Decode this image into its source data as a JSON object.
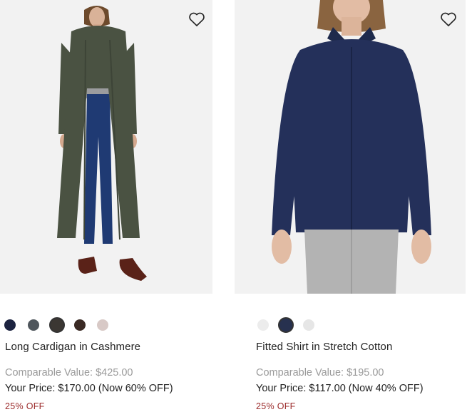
{
  "products": [
    {
      "name": "Long Cardigan in Cashmere",
      "comparable_value": "Comparable Value: $425.00",
      "your_price": "Your Price: $170.00 (Now 60% OFF)",
      "discount": "25% OFF",
      "favorite_icon": "heart-outline-icon",
      "swatches": [
        "#1c2340",
        "#4f565c",
        "#3b3733",
        "#3a2a24",
        "#d8c9c6"
      ],
      "selected_swatch": 2
    },
    {
      "name": "Fitted Shirt in Stretch Cotton",
      "comparable_value": "Comparable Value: $195.00",
      "your_price": "Your Price: $117.00 (Now 40% OFF)",
      "discount": "25% OFF",
      "favorite_icon": "heart-outline-icon",
      "swatches": [
        "#ececec",
        "#27314f",
        "#e6e6e6"
      ],
      "selected_swatch": 1
    }
  ],
  "colors": {
    "discount": "#9b2a2a",
    "comparable": "#9a9a9a",
    "image_bg": "#f2f2f2"
  }
}
